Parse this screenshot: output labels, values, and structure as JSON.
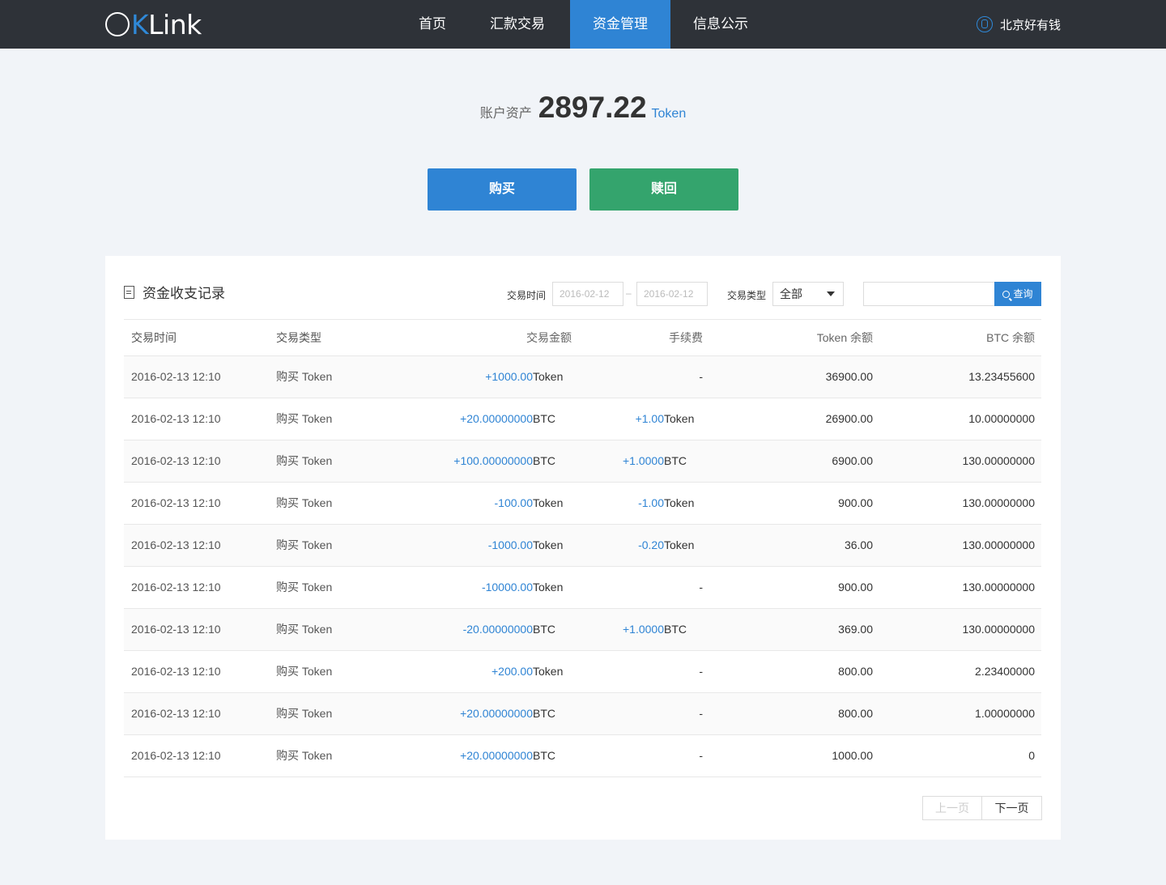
{
  "nav": {
    "logo": "OKLink",
    "items": [
      "首页",
      "汇款交易",
      "资金管理",
      "信息公示"
    ],
    "user": "北京好有钱"
  },
  "balance": {
    "label": "账户资产",
    "amount": "2897.22",
    "unit": "Token"
  },
  "actions": {
    "buy": "购买",
    "redeem": "赎回"
  },
  "panel": {
    "title": "资金收支记录",
    "filters": {
      "time_label": "交易时间",
      "date_from": "2016-02-12",
      "date_sep": "–",
      "date_to": "2016-02-12",
      "type_label": "交易类型",
      "type_value": "全部",
      "search_value": "",
      "query": "查询"
    },
    "columns": [
      "交易时间",
      "交易类型",
      "交易金额",
      "手续费",
      "Token 余额",
      "BTC 余额"
    ],
    "rows": [
      {
        "time": "2016-02-13  12:10",
        "type": "购买 Token",
        "amount": "+1000.00",
        "amount_unit": "Token",
        "fee": "",
        "fee_unit": "",
        "token": "36900.00",
        "btc": "13.23455600"
      },
      {
        "time": "2016-02-13  12:10",
        "type": "购买 Token",
        "amount": "+20.00000000",
        "amount_unit": "BTC",
        "fee": "+1.00",
        "fee_unit": "Token",
        "token": "26900.00",
        "btc": "10.00000000"
      },
      {
        "time": "2016-02-13  12:10",
        "type": "购买 Token",
        "amount": "+100.00000000",
        "amount_unit": "BTC",
        "fee": "+1.0000",
        "fee_unit": "BTC",
        "token": "6900.00",
        "btc": "130.00000000"
      },
      {
        "time": "2016-02-13  12:10",
        "type": "购买 Token",
        "amount": "-100.00",
        "amount_unit": "Token",
        "fee": "-1.00",
        "fee_unit": "Token",
        "token": "900.00",
        "btc": "130.00000000"
      },
      {
        "time": "2016-02-13  12:10",
        "type": "购买 Token",
        "amount": "-1000.00",
        "amount_unit": "Token",
        "fee": "-0.20",
        "fee_unit": "Token",
        "token": "36.00",
        "btc": "130.00000000"
      },
      {
        "time": "2016-02-13  12:10",
        "type": "购买 Token",
        "amount": "-10000.00",
        "amount_unit": "Token",
        "fee": "",
        "fee_unit": "",
        "token": "900.00",
        "btc": "130.00000000"
      },
      {
        "time": "2016-02-13  12:10",
        "type": "购买 Token",
        "amount": "-20.00000000",
        "amount_unit": "BTC",
        "fee": "+1.0000",
        "fee_unit": "BTC",
        "token": "369.00",
        "btc": "130.00000000"
      },
      {
        "time": "2016-02-13  12:10",
        "type": "购买 Token",
        "amount": "+200.00",
        "amount_unit": "Token",
        "fee": "",
        "fee_unit": "",
        "token": "800.00",
        "btc": "2.23400000"
      },
      {
        "time": "2016-02-13  12:10",
        "type": "购买 Token",
        "amount": "+20.00000000",
        "amount_unit": "BTC",
        "fee": "",
        "fee_unit": "",
        "token": "800.00",
        "btc": "1.00000000"
      },
      {
        "time": "2016-02-13  12:10",
        "type": "购买 Token",
        "amount": "+20.00000000",
        "amount_unit": "BTC",
        "fee": "",
        "fee_unit": "",
        "token": "1000.00",
        "btc": "0"
      }
    ],
    "empty_fee": "-",
    "pager": {
      "prev": "上一页",
      "next": "下一页"
    }
  },
  "colors": {
    "topbar": "#2e3238",
    "accent": "#2f84d4",
    "redeem": "#34a46d",
    "background": "#f1f4f8"
  }
}
